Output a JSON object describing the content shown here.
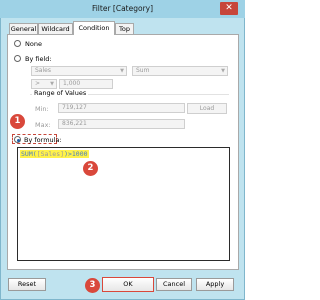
{
  "window": {
    "title": "Filter [Category]",
    "close_glyph": "✕"
  },
  "tabs": [
    {
      "label": "General",
      "active": false
    },
    {
      "label": "Wildcard",
      "active": false
    },
    {
      "label": "Condition",
      "active": true
    },
    {
      "label": "Top",
      "active": false
    }
  ],
  "condition": {
    "none_label": "None",
    "by_field_label": "By field:",
    "field_select": "Sales",
    "aggregation_select": "Sum",
    "operator_select": ">",
    "value_input": "1,000",
    "range_title": "Range of Values",
    "min_label": "Min:",
    "min_value": "719,127",
    "max_label": "Max:",
    "max_value": "836,221",
    "load_button": "Load",
    "by_formula_label": "By formula:",
    "selected": "By formula:"
  },
  "formula": {
    "func": "SUM(",
    "field": "[Sales]",
    "rest": ")>1000"
  },
  "buttons": {
    "reset": "Reset",
    "ok": "OK",
    "cancel": "Cancel",
    "apply": "Apply"
  },
  "markers": [
    "1",
    "2",
    "3"
  ],
  "colors": {
    "marker": "#d9483b",
    "highlight": "#fff24a",
    "titlebar": "#9ed2e6",
    "formula_text": "#4a7fbf"
  }
}
